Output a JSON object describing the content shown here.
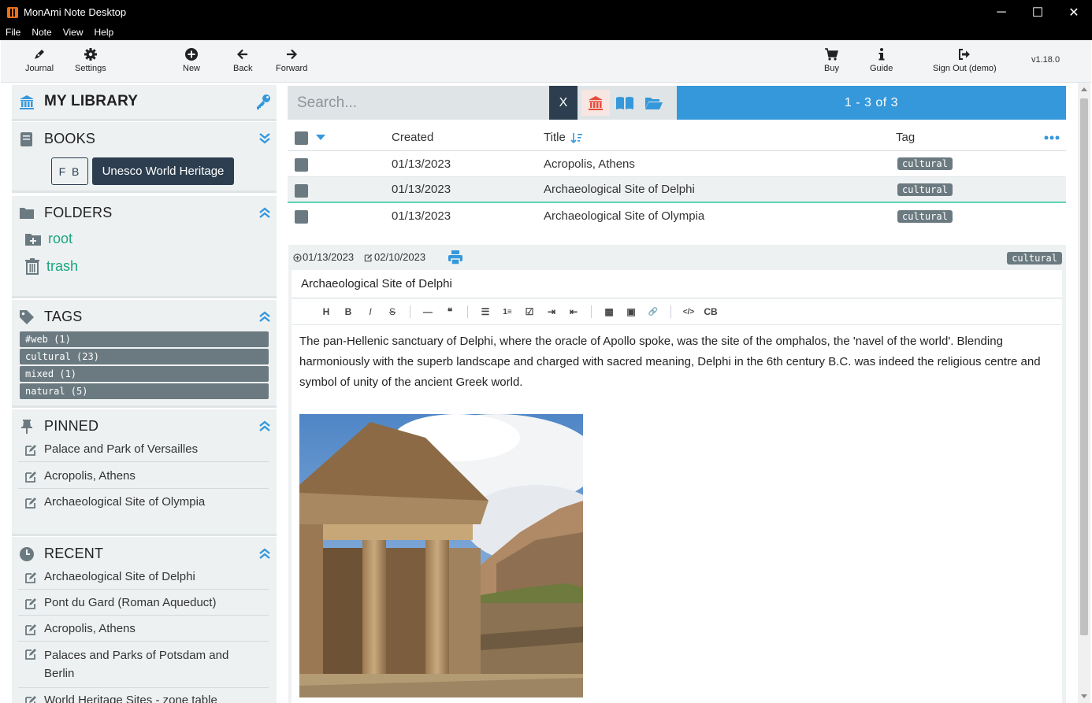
{
  "window": {
    "title": "MonAmi Note Desktop",
    "minimize": "─",
    "maximize": "☐",
    "close": "✕"
  },
  "menu": [
    "File",
    "Note",
    "View",
    "Help"
  ],
  "toolbar": {
    "journal": "Journal",
    "settings": "Settings",
    "new": "New",
    "back": "Back",
    "forward": "Forward",
    "buy": "Buy",
    "guide": "Guide",
    "sign_out": "Sign Out (demo)",
    "version": "v1.18.0"
  },
  "sidebar": {
    "library": {
      "title": "MY LIBRARY"
    },
    "books": {
      "title": "BOOKS",
      "fb_label": "F B",
      "active_book": "Unesco World Heritage"
    },
    "folders": {
      "title": "FOLDERS",
      "items": [
        "root",
        "trash"
      ]
    },
    "tags": {
      "title": "TAGS",
      "items": [
        "#web (1)",
        "cultural (23)",
        "mixed (1)",
        "natural (5)"
      ]
    },
    "pinned": {
      "title": "PINNED",
      "items": [
        "Palace and Park of Versailles",
        "Acropolis, Athens",
        "Archaeological Site of Olympia"
      ]
    },
    "recent": {
      "title": "RECENT",
      "items": [
        "Archaeological Site of Delphi",
        "Pont du Gard (Roman Aqueduct)",
        "Acropolis, Athens",
        "Palaces and Parks of Potsdam and Berlin",
        "World Heritage Sites - zone table"
      ]
    }
  },
  "search": {
    "placeholder": "Search...",
    "clear": "X",
    "results": "1 - 3  of  3"
  },
  "table": {
    "headers": {
      "created": "Created",
      "title": "Title",
      "tag": "Tag"
    },
    "rows": [
      {
        "created": "01/13/2023",
        "title": "Acropolis, Athens",
        "tag": "cultural"
      },
      {
        "created": "01/13/2023",
        "title": "Archaeological Site of Delphi",
        "tag": "cultural"
      },
      {
        "created": "01/13/2023",
        "title": "Archaeological Site of Olympia",
        "tag": "cultural"
      }
    ]
  },
  "note": {
    "created": "01/13/2023",
    "modified": "02/10/2023",
    "tag": "cultural",
    "title": "Archaeological Site of Delphi",
    "toolbar": [
      "H",
      "B",
      "I",
      "S",
      "—",
      "❝",
      "☰",
      "1≡",
      "☑",
      "⇥",
      "⇤",
      "▦",
      "▣",
      "🔗",
      "</>",
      "CB"
    ],
    "body": "The pan-Hellenic sanctuary of Delphi, where the oracle of Apollo spoke, was the site of the omphalos, the 'navel of the world'. Blending harmoniously with the superb landscape and charged with sacred meaning, Delphi in the 6th century B.C. was indeed the religious centre and symbol of unity of the ancient Greek world."
  },
  "colors": {
    "accent": "#3498db",
    "dark": "#2c3e50",
    "folder_link": "#1aa67f",
    "tag_badge": "#6b7a80",
    "selected_underline": "#5fd3b5"
  }
}
